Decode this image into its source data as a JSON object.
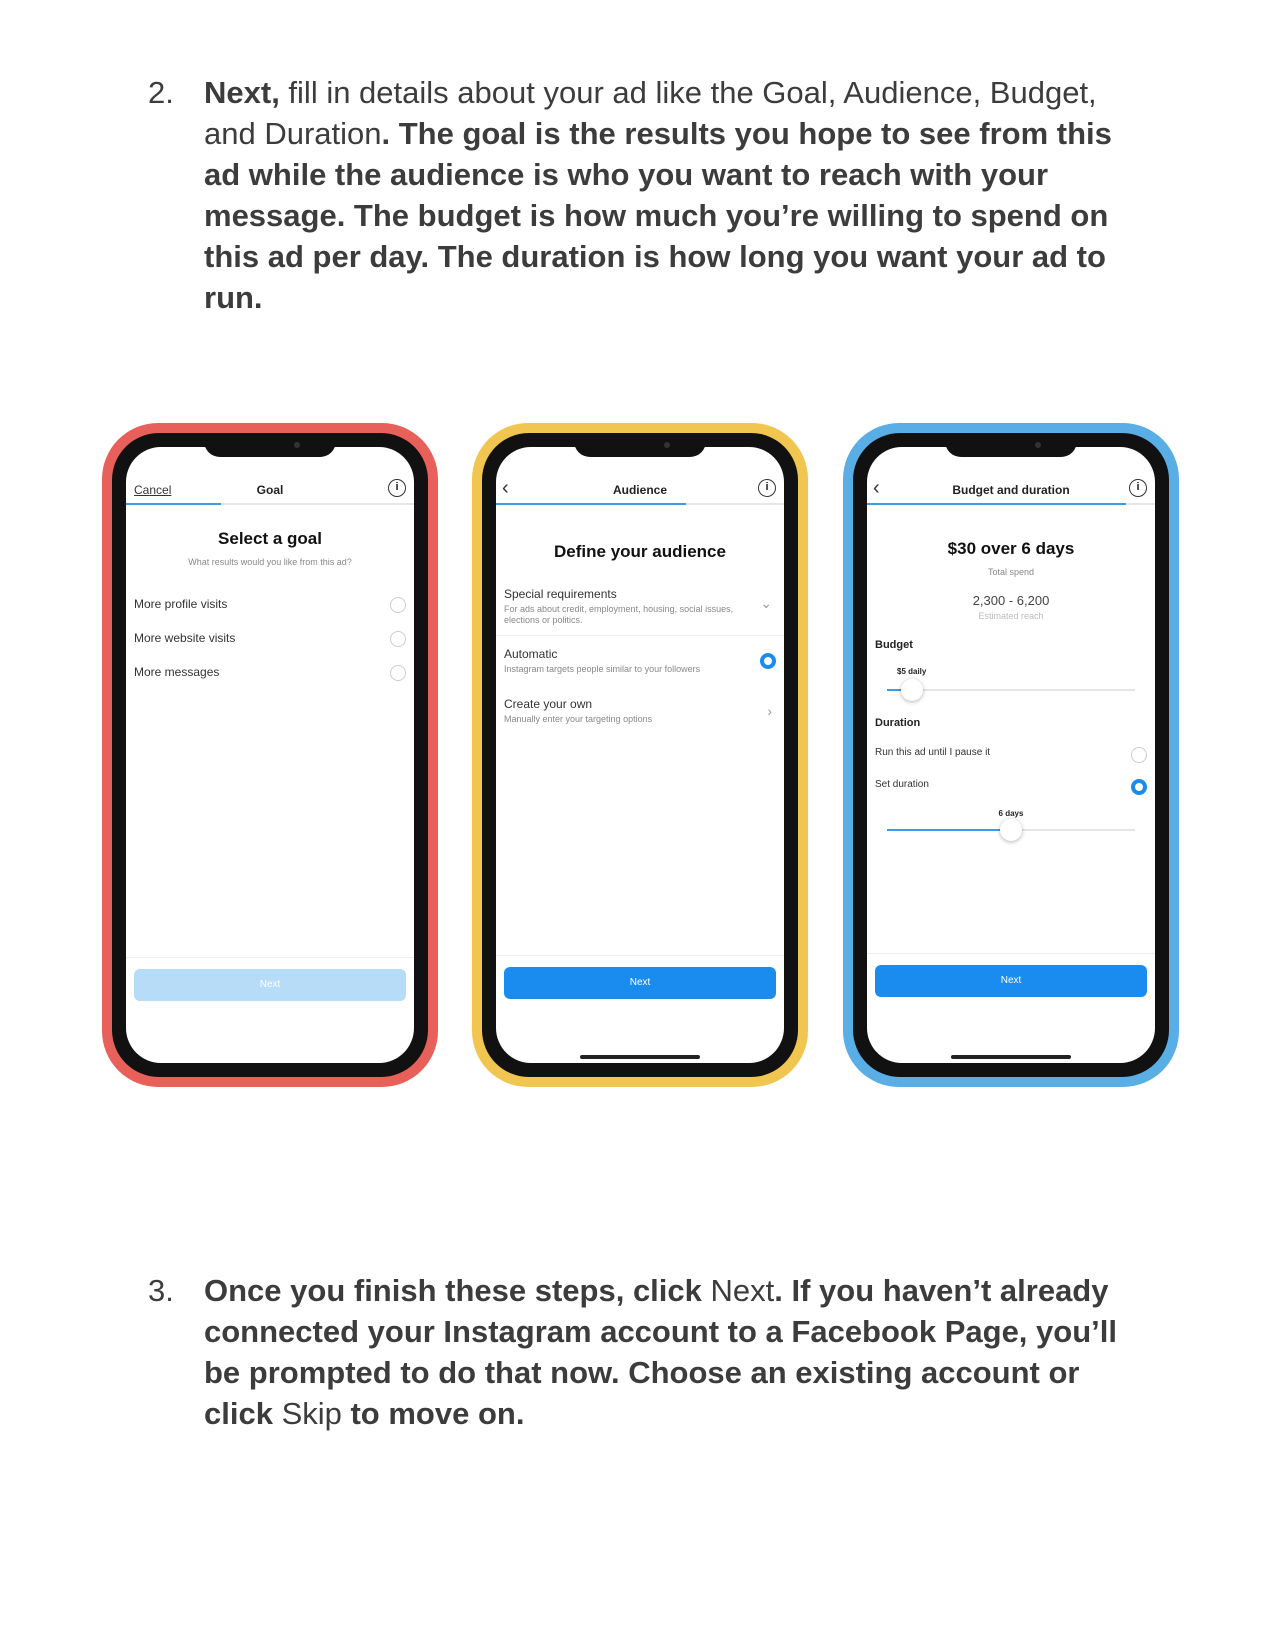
{
  "step2": {
    "number": "2.",
    "lead_bold": "Next,",
    "lead_normal": " fill in details about your ad like the Goal, Audience, Budget, and Duration",
    "rest_bold": ". The goal is the results you hope to see from this ad while the audience is who you want to reach with your message. The budget is how much you’re willing to spend on this ad per day. The duration is how long you want your ad to run."
  },
  "phone1": {
    "cancel": "Cancel",
    "title": "Goal",
    "info_icon": "i",
    "heading": "Select a goal",
    "subheading": "What results would you like from this ad?",
    "options": [
      "More profile visits",
      "More website visits",
      "More messages"
    ],
    "next": "Next",
    "progress": 0.33
  },
  "phone2": {
    "title": "Audience",
    "info_icon": "i",
    "heading": "Define your audience",
    "special_label": "Special requirements",
    "special_desc": "For ads about credit, employment, housing, social issues, elections or politics.",
    "automatic_label": "Automatic",
    "automatic_desc": "Instagram targets people similar to your followers",
    "create_label": "Create your own",
    "create_desc": "Manually enter your targeting options",
    "next": "Next",
    "progress": 0.66
  },
  "phone3": {
    "title": "Budget and duration",
    "info_icon": "i",
    "heading": "$30 over 6 days",
    "total_spend_label": "Total spend",
    "reach": "2,300 - 6,200",
    "reach_label": "Estimated reach",
    "budget_label": "Budget",
    "budget_value": "$5 daily",
    "budget_level": 0.1,
    "duration_label": "Duration",
    "run_until_label": "Run this ad until I pause it",
    "set_duration_label": "Set duration",
    "duration_value": "6 days",
    "duration_level": 0.5,
    "next": "Next",
    "progress": 0.9
  },
  "step3": {
    "number": "3.",
    "p1_bold": "Once you finish these steps, click ",
    "p1_normal": "Next",
    "p2_bold": ". If you haven’t already connected your Instagram account to a Facebook Page, you’ll be prompted to do that now. Choose an existing account or click ",
    "p2_normal": "Skip",
    "p3_bold": " to move on."
  }
}
